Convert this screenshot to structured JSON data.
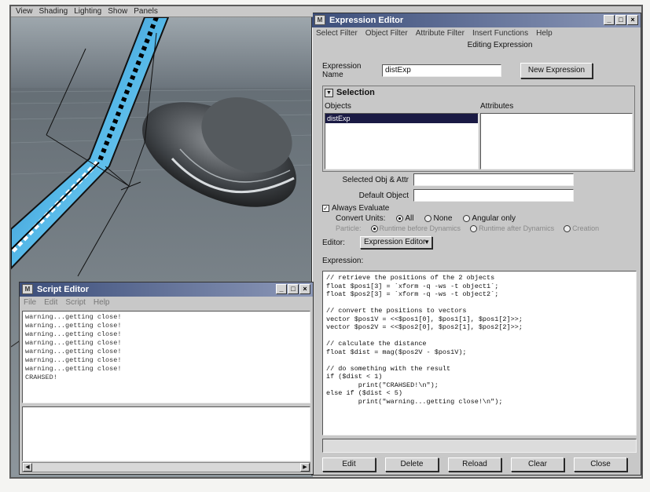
{
  "viewport": {
    "menu": [
      "View",
      "Shading",
      "Lighting",
      "Show",
      "Panels"
    ]
  },
  "expression_editor": {
    "title": "Expression Editor",
    "menu": [
      "Select Filter",
      "Object Filter",
      "Attribute Filter",
      "Insert Functions",
      "Help"
    ],
    "mode_label": "Editing Expression",
    "name_label": "Expression Name",
    "name_value": "distExp",
    "new_button": "New Expression",
    "selection_header": "Selection",
    "objects_label": "Objects",
    "attributes_label": "Attributes",
    "objects_selected": "distExp",
    "selected_obj_label": "Selected Obj & Attr",
    "default_object_label": "Default Object",
    "always_evaluate": "Always Evaluate",
    "convert_units_label": "Convert Units:",
    "convert_options": [
      "All",
      "None",
      "Angular only"
    ],
    "particle_label": "Particle:",
    "particle_options": [
      "Runtime before Dynamics",
      "Runtime after Dynamics",
      "Creation"
    ],
    "editor_label": "Editor:",
    "editor_value": "Expression Editor",
    "expression_label": "Expression:",
    "code": "// retrieve the positions of the 2 objects\nfloat $pos1[3] = `xform -q -ws -t object1`;\nfloat $pos2[3] = `xform -q -ws -t object2`;\n\n// convert the positions to vectors\nvector $pos1V = <<$pos1[0], $pos1[1], $pos1[2]>>;\nvector $pos2V = <<$pos2[0], $pos2[1], $pos2[2]>>;\n\n// calculate the distance\nfloat $dist = mag($pos2V - $pos1V);\n\n// do something with the result\nif ($dist < 1)\n        print(\"CRAHSED!\\n\");\nelse if ($dist < 5)\n        print(\"warning...getting close!\\n\");",
    "buttons": [
      "Edit",
      "Delete",
      "Reload",
      "Clear",
      "Close"
    ]
  },
  "script_editor": {
    "title": "Script Editor",
    "menu": [
      "File",
      "Edit",
      "Script",
      "Help"
    ],
    "output": "warning...getting close!\nwarning...getting close!\nwarning...getting close!\nwarning...getting close!\nwarning...getting close!\nwarning...getting close!\nwarning...getting close!\nCRAHSED!"
  },
  "window_controls": {
    "minimize": "_",
    "maximize": "□",
    "close": "×"
  }
}
